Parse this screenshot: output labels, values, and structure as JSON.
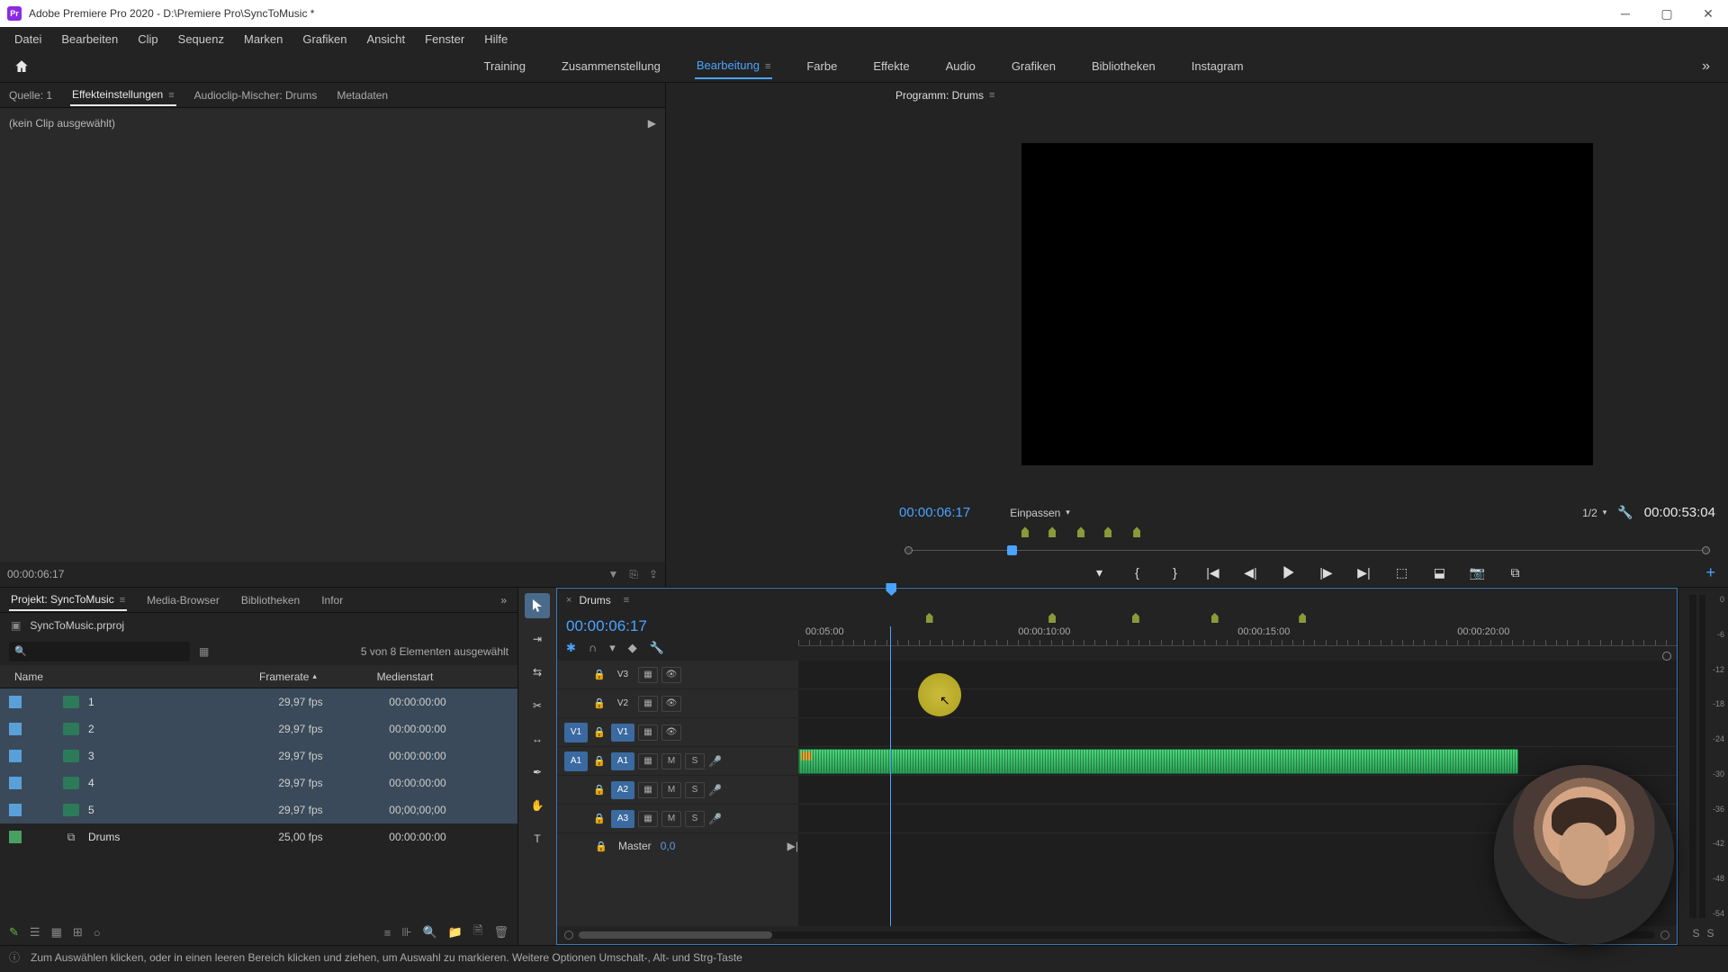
{
  "titlebar": {
    "title": "Adobe Premiere Pro 2020 - D:\\Premiere Pro\\SyncToMusic *"
  },
  "menubar": [
    "Datei",
    "Bearbeiten",
    "Clip",
    "Sequenz",
    "Marken",
    "Grafiken",
    "Ansicht",
    "Fenster",
    "Hilfe"
  ],
  "workspaces": {
    "items": [
      "Training",
      "Zusammenstellung",
      "Bearbeitung",
      "Farbe",
      "Effekte",
      "Audio",
      "Grafiken",
      "Bibliotheken",
      "Instagram"
    ],
    "active_index": 2
  },
  "source_panel": {
    "tabs": [
      "Quelle: 1",
      "Effekteinstellungen",
      "Audioclip-Mischer: Drums",
      "Metadaten"
    ],
    "active_tab": 1,
    "empty_msg": "(kein Clip ausgewählt)",
    "footer_tc": "00:00:06:17"
  },
  "program_panel": {
    "title": "Programm: Drums",
    "timecode_left": "00:00:06:17",
    "fit_label": "Einpassen",
    "quality_label": "1/2",
    "timecode_right": "00:00:53:04",
    "markers_pct": [
      14.2,
      17.6,
      21.2,
      24.6,
      28.2
    ],
    "playhead_pct": 12.4
  },
  "project_panel": {
    "tabs": [
      "Projekt: SyncToMusic",
      "Media-Browser",
      "Bibliotheken",
      "Infor"
    ],
    "active_tab": 0,
    "project_file": "SyncToMusic.prproj",
    "selection_count": "5 von 8 Elementen ausgewählt",
    "columns": {
      "name": "Name",
      "framerate": "Framerate",
      "mediastart": "Medienstart"
    },
    "rows": [
      {
        "label_color": "#5aa0d8",
        "icon": "clip",
        "name": "1",
        "framerate": "29,97 fps",
        "mediastart": "00:00:00:00",
        "selected": true
      },
      {
        "label_color": "#5aa0d8",
        "icon": "clip",
        "name": "2",
        "framerate": "29,97 fps",
        "mediastart": "00:00:00:00",
        "selected": true
      },
      {
        "label_color": "#5aa0d8",
        "icon": "clip",
        "name": "3",
        "framerate": "29,97 fps",
        "mediastart": "00:00:00:00",
        "selected": true
      },
      {
        "label_color": "#5aa0d8",
        "icon": "clip",
        "name": "4",
        "framerate": "29,97 fps",
        "mediastart": "00:00:00:00",
        "selected": true
      },
      {
        "label_color": "#5aa0d8",
        "icon": "clip",
        "name": "5",
        "framerate": "29,97 fps",
        "mediastart": "00;00;00;00",
        "selected": true
      },
      {
        "label_color": "#4aa060",
        "icon": "sequence",
        "name": "Drums",
        "framerate": "25,00 fps",
        "mediastart": "00:00:00:00",
        "selected": false
      }
    ]
  },
  "timeline": {
    "tab_name": "Drums",
    "timecode": "00:00:06:17",
    "ruler_labels": [
      {
        "text": "00:05:00",
        "pct": 3
      },
      {
        "text": "00:00:10:00",
        "pct": 28
      },
      {
        "text": "00:00:15:00",
        "pct": 53
      },
      {
        "text": "00:00:20:00",
        "pct": 78
      }
    ],
    "markers_pct": [
      14.5,
      28.5,
      38,
      47,
      57
    ],
    "playhead_pct": 10.5,
    "video_tracks": [
      {
        "src": "",
        "label": "V3",
        "targeted": false
      },
      {
        "src": "",
        "label": "V2",
        "targeted": false
      },
      {
        "src": "V1",
        "label": "V1",
        "targeted": true
      }
    ],
    "audio_tracks": [
      {
        "src": "A1",
        "label": "A1",
        "targeted": true
      },
      {
        "src": "",
        "label": "A2",
        "targeted": true
      },
      {
        "src": "",
        "label": "A3",
        "targeted": true
      }
    ],
    "master": {
      "label": "Master",
      "value": "0,0"
    },
    "audio_clip": {
      "track_index": 0,
      "start_pct": 0,
      "width_pct": 82
    }
  },
  "meters": {
    "scale": [
      "0",
      "-6",
      "-12",
      "-18",
      "-24",
      "-30",
      "-36",
      "-42",
      "-48",
      "-54"
    ],
    "solo_label": "S"
  },
  "statusbar": {
    "text": "Zum Auswählen klicken, oder in einen leeren Bereich klicken und ziehen, um Auswahl zu markieren. Weitere Optionen Umschalt-, Alt- und Strg-Taste"
  }
}
